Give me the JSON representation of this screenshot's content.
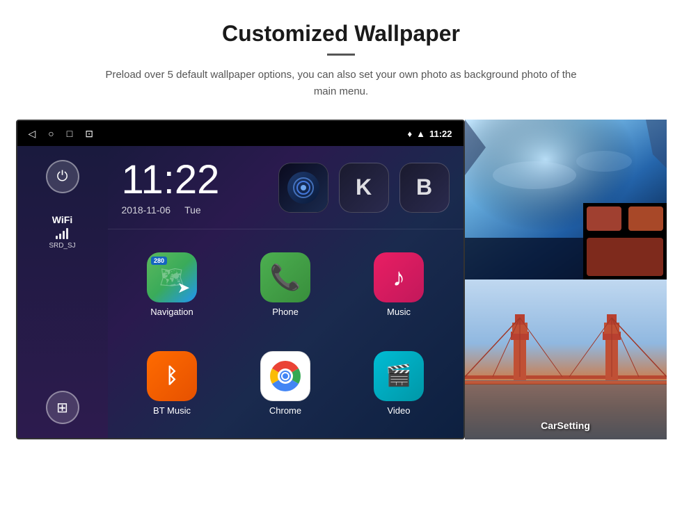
{
  "page": {
    "title": "Customized Wallpaper",
    "description": "Preload over 5 default wallpaper options, you can also set your own photo as background photo of the main menu."
  },
  "device": {
    "time": "11:22",
    "date_left": "2018-11-06",
    "date_right": "Tue",
    "wifi_label": "WiFi",
    "wifi_ssid": "SRD_SJ",
    "status_time": "11:22"
  },
  "apps": [
    {
      "label": "Navigation",
      "type": "navigation"
    },
    {
      "label": "Phone",
      "type": "phone"
    },
    {
      "label": "Music",
      "type": "music"
    },
    {
      "label": "BT Music",
      "type": "btmusic"
    },
    {
      "label": "Chrome",
      "type": "chrome"
    },
    {
      "label": "Video",
      "type": "video"
    }
  ],
  "top_apps": [
    {
      "type": "radio",
      "letter": ""
    },
    {
      "type": "letter",
      "letter": "K"
    },
    {
      "type": "letter2",
      "letter": "B"
    }
  ],
  "wallpapers": [
    {
      "label": "",
      "type": "ice"
    },
    {
      "label": "CarSetting",
      "type": "bridge"
    }
  ],
  "icons": {
    "back": "◁",
    "home": "○",
    "recents": "□",
    "screenshot": "⊡",
    "location": "♦",
    "signal": "▲",
    "power": "⏻",
    "apps_grid": "⊞"
  }
}
